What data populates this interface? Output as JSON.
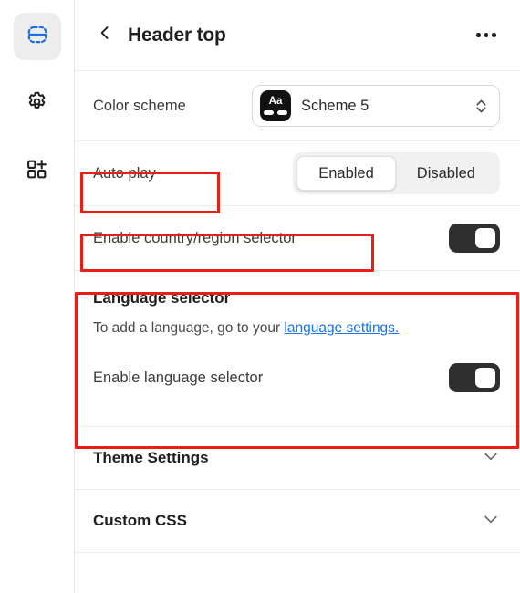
{
  "sidebar": {
    "items": [
      {
        "name": "sections-icon",
        "label": "Sections",
        "active": true
      },
      {
        "name": "gear-icon",
        "label": "Settings",
        "active": false
      },
      {
        "name": "apps-add-icon",
        "label": "Add app block",
        "active": false
      }
    ]
  },
  "header": {
    "back_label": "Back",
    "title": "Header top",
    "more_label": "More options"
  },
  "color_scheme": {
    "label": "Color scheme",
    "swatch_text": "Aa",
    "value": "Scheme 5"
  },
  "auto_play": {
    "label": "Auto play",
    "options": [
      "Enabled",
      "Disabled"
    ],
    "selected": "Enabled"
  },
  "country_region": {
    "label": "Enable country/region selector",
    "enabled": true
  },
  "language_selector": {
    "title": "Language selector",
    "description_prefix": "To add a language, go to your ",
    "link_text": "language settings.",
    "toggle_label": "Enable language selector",
    "enabled": true
  },
  "accordions": [
    {
      "title": "Theme Settings"
    },
    {
      "title": "Custom CSS"
    }
  ],
  "annotation_color": "#ec1c16",
  "colors": {
    "accent_blue": "#1a6fe8",
    "link_blue": "#1a73e8",
    "toggle_on": "#2f2f2f",
    "swatch_bg": "#121212",
    "segment_track": "#f1f1f1"
  }
}
